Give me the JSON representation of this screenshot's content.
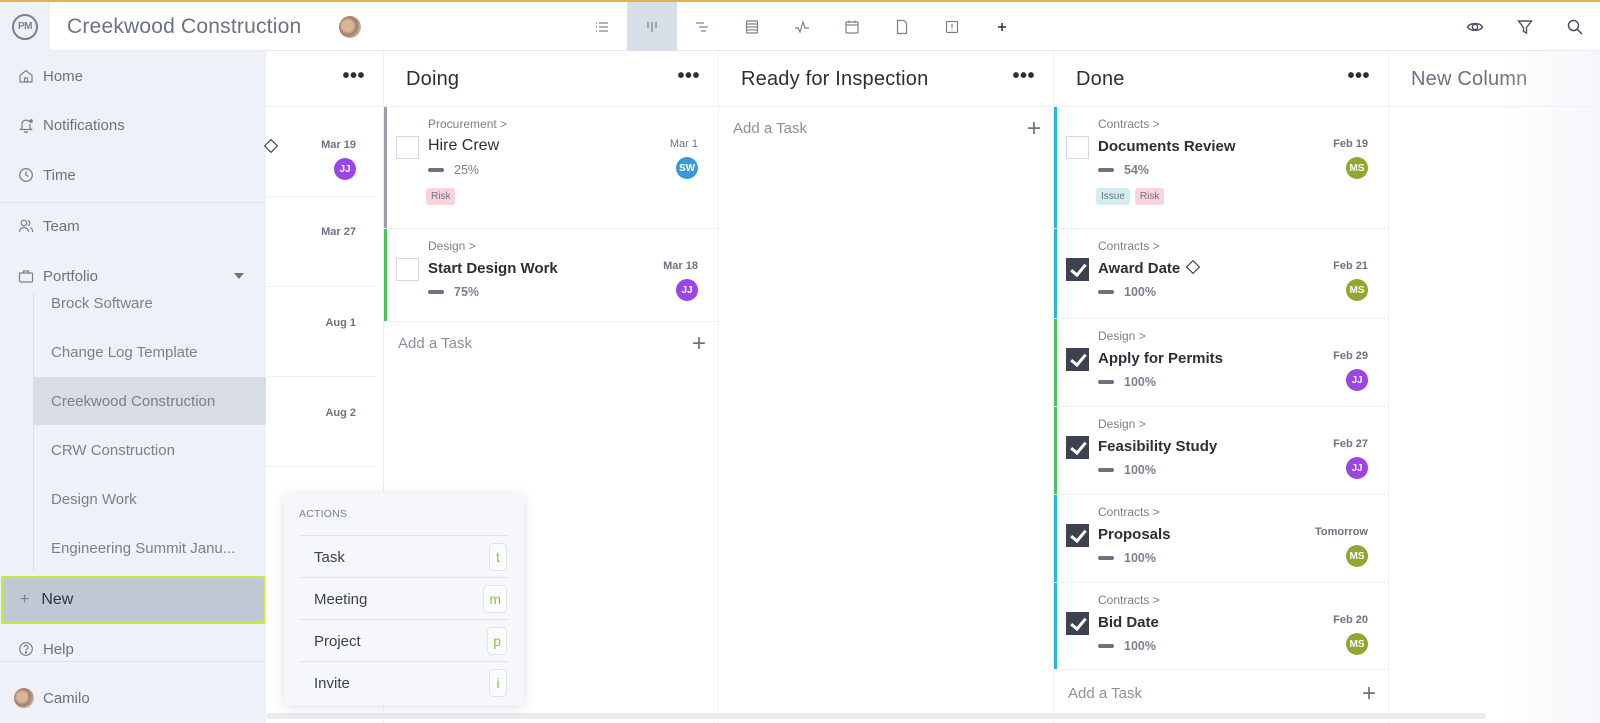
{
  "app": {
    "logo": "PM",
    "title": "Creekwood Construction"
  },
  "toolbar": {
    "views": [
      {
        "name": "list-view",
        "active": false
      },
      {
        "name": "board-view",
        "active": true
      },
      {
        "name": "gantt-view",
        "active": false
      },
      {
        "name": "sheet-view",
        "active": false
      },
      {
        "name": "dashboard-view",
        "active": false
      },
      {
        "name": "calendar-view",
        "active": false
      },
      {
        "name": "files-view",
        "active": false
      },
      {
        "name": "issues-view",
        "active": false
      },
      {
        "name": "add-view",
        "active": false
      }
    ],
    "right": [
      "eye-icon",
      "filter-icon",
      "search-icon"
    ]
  },
  "sidebar": {
    "items": [
      {
        "label": "Home",
        "icon": "home-icon"
      },
      {
        "label": "Notifications",
        "icon": "bell-icon"
      },
      {
        "label": "Time",
        "icon": "clock-icon"
      },
      {
        "label": "Team",
        "icon": "users-icon"
      },
      {
        "label": "Portfolio",
        "icon": "briefcase-icon"
      }
    ],
    "portfolio": [
      {
        "label": "Brock Software",
        "active": false
      },
      {
        "label": "Change Log Template",
        "active": false
      },
      {
        "label": "Creekwood Construction",
        "active": true
      },
      {
        "label": "CRW Construction",
        "active": false
      },
      {
        "label": "Design Work",
        "active": false
      },
      {
        "label": "Engineering Summit Janu...",
        "active": false
      }
    ],
    "new_label": "New",
    "help_label": "Help",
    "user_label": "Camilo"
  },
  "board": {
    "partial_column": {
      "rows": [
        {
          "date": "Mar 19",
          "assignee": "JJ",
          "milestone": true
        },
        {
          "date": "Mar 27"
        },
        {
          "date": "Aug 1"
        },
        {
          "date": "Aug 2"
        }
      ]
    },
    "columns": [
      {
        "title": "Doing",
        "cards": [
          {
            "parent": "Procurement >",
            "title": "Hire Crew",
            "progress": "25%",
            "date": "Mar 1",
            "assignee": "SW",
            "checked": false,
            "bold": false,
            "tags": [
              "Risk"
            ],
            "bar": "#9aa0aa"
          },
          {
            "parent": "Design >",
            "title": "Start Design Work",
            "progress": "75%",
            "date": "Mar 18",
            "assignee": "JJ",
            "checked": false,
            "bold": true,
            "tags": [],
            "bar": "#4cc35a"
          }
        ],
        "add_label": "Add a Task"
      },
      {
        "title": "Ready for Inspection",
        "cards": [],
        "add_label": "Add a Task"
      },
      {
        "title": "Done",
        "cards": [
          {
            "parent": "Contracts >",
            "title": "Documents Review",
            "progress": "54%",
            "date": "Feb 19",
            "assignee": "MS",
            "checked": false,
            "bold": true,
            "tags": [
              "Issue",
              "Risk"
            ],
            "bar": "#22b8d8"
          },
          {
            "parent": "Contracts >",
            "title": "Award Date",
            "milestone": true,
            "progress": "100%",
            "date": "Feb 21",
            "assignee": "MS",
            "checked": true,
            "bold": true,
            "tags": [],
            "bar": "#22b8d8"
          },
          {
            "parent": "Design >",
            "title": "Apply for Permits",
            "progress": "100%",
            "date": "Feb 29",
            "assignee": "JJ",
            "checked": true,
            "bold": true,
            "tags": [],
            "bar": "#4cc35a"
          },
          {
            "parent": "Design >",
            "title": "Feasibility Study",
            "progress": "100%",
            "date": "Feb 27",
            "assignee": "JJ",
            "checked": true,
            "bold": true,
            "tags": [],
            "bar": "#4cc35a"
          },
          {
            "parent": "Contracts >",
            "title": "Proposals",
            "progress": "100%",
            "date": "Tomorrow",
            "assignee": "MS",
            "checked": true,
            "bold": true,
            "tags": [],
            "bar": "#22b8d8"
          },
          {
            "parent": "Contracts >",
            "title": "Bid Date",
            "progress": "100%",
            "date": "Feb 20",
            "assignee": "MS",
            "checked": true,
            "bold": true,
            "tags": [],
            "bar": "#22b8d8"
          }
        ],
        "add_label": "Add a Task"
      },
      {
        "title": "New Column",
        "placeholder": true
      }
    ]
  },
  "actions_menu": {
    "heading": "ACTIONS",
    "items": [
      {
        "label": "Task",
        "shortcut": "t"
      },
      {
        "label": "Meeting",
        "shortcut": "m"
      },
      {
        "label": "Project",
        "shortcut": "p"
      },
      {
        "label": "Invite",
        "shortcut": "i"
      }
    ]
  },
  "colors": {
    "avatar_JJ": "#9b45e4",
    "avatar_SW": "#3a9ad9",
    "avatar_MS": "#8fa832",
    "tag_Risk": "#fbd3dc",
    "tag_Issue": "#d3eef0",
    "highlight": "#c3eb3c",
    "accent_top": "#e8b04a"
  }
}
